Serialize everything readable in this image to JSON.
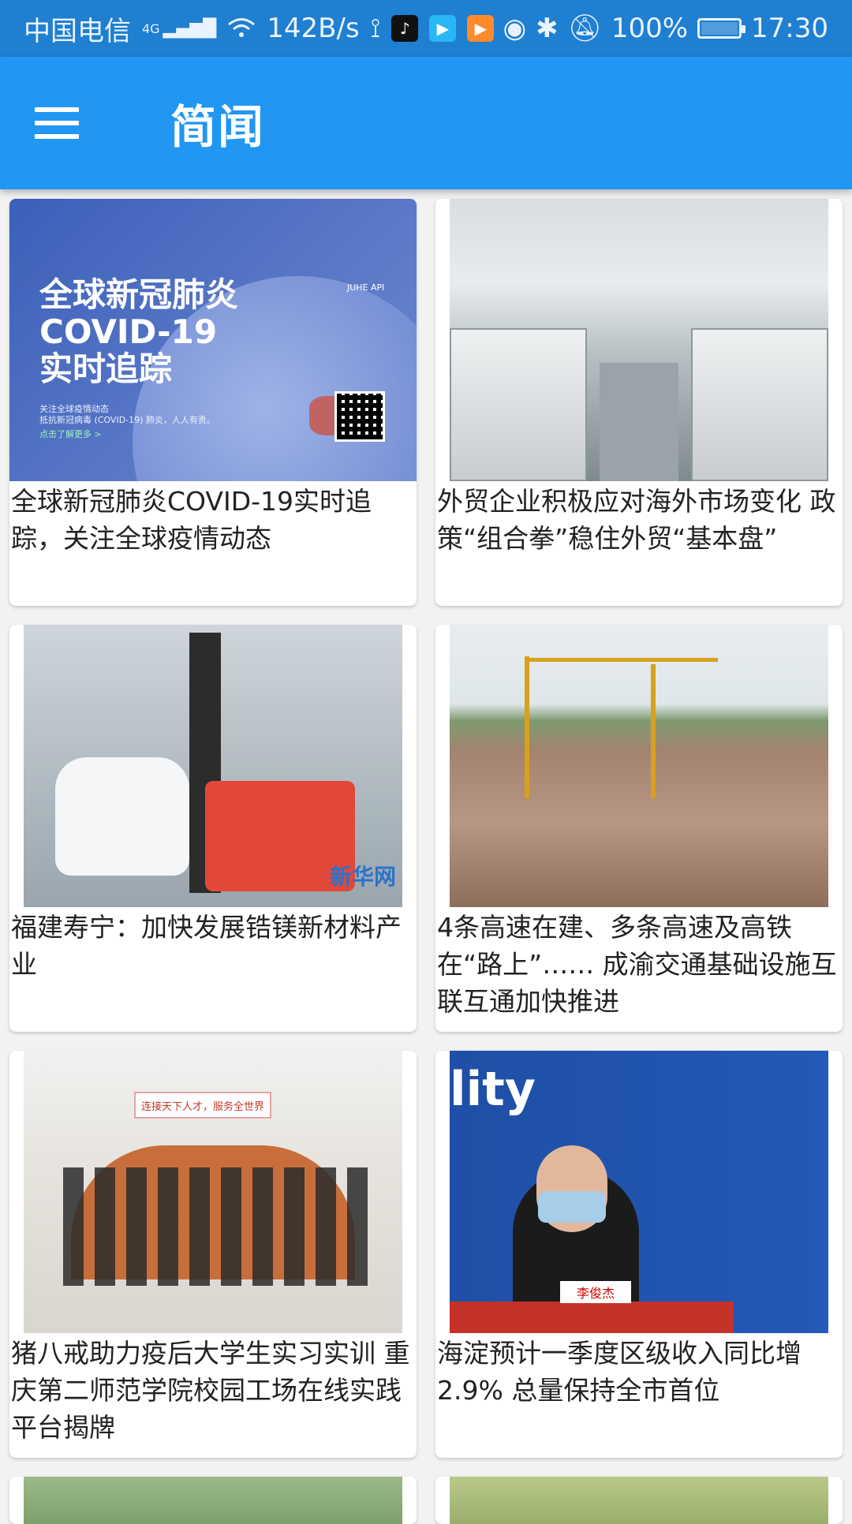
{
  "status_bar": {
    "carrier": "中国电信",
    "network": "4G",
    "speed": "142B/s",
    "battery": "100%",
    "time": "17:30"
  },
  "app_bar": {
    "title": "简闻"
  },
  "news": [
    {
      "title": "全球新冠肺炎COVID-19实时追踪，关注全球疫情动态",
      "image": {
        "headline_lines": [
          "全球新冠肺炎",
          "COVID-19",
          "实时追踪"
        ],
        "caption": "关注全球疫情动态\n抵抗新冠病毒 (COVID-19) 肺炎，人人有责。",
        "link": "点击了解更多 >",
        "brand": "JUHE API"
      }
    },
    {
      "title": "外贸企业积极应对海外市场变化 政策“组合拳”稳住外贸“基本盘”"
    },
    {
      "title": "福建寿宁：加快发展锆镁新材料产业",
      "image": {
        "watermark": "新华网"
      }
    },
    {
      "title": "4条高速在建、多条高速及高铁在“路上”…… 成渝交通基础设施互联互通加快推进"
    },
    {
      "title": "猪八戒助力疫后大学生实习实训 重庆第二师范学院校园工场在线实践平台揭牌",
      "image": {
        "sign": "连接天下人才，服务全世界"
      }
    },
    {
      "title": "海淀预计一季度区级收入同比增2.9% 总量保持全市首位",
      "image": {
        "backdrop_text": "lity",
        "nameplate": "李俊杰"
      }
    }
  ],
  "colors": {
    "status_bar": "#1f7fd1",
    "app_bar": "#2196f3",
    "background": "#f2f2f2",
    "card": "#ffffff"
  }
}
